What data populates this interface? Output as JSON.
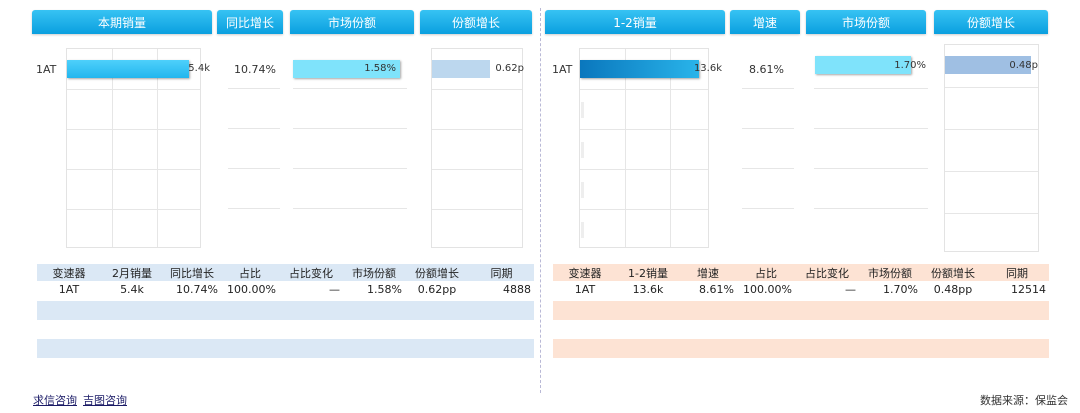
{
  "left": {
    "headers": {
      "sales": "本期销量",
      "yoy": "同比增长",
      "share": "市场份额",
      "share_growth": "份额增长"
    },
    "row_label": "1AT",
    "sales_value": "5.4k",
    "yoy_value": "10.74%",
    "share_value": "1.58%",
    "share_growth_value": "0.62p",
    "table": {
      "columns": [
        "变速器",
        "2月销量",
        "同比增长",
        "占比",
        "占比变化",
        "市场份额",
        "份额增长",
        "同期"
      ],
      "rows": [
        [
          "1AT",
          "5.4k",
          "10.74%",
          "100.00%",
          "—",
          "1.58%",
          "0.62pp",
          "4888"
        ]
      ]
    }
  },
  "right": {
    "headers": {
      "sales": "1-2销量",
      "speed": "增速",
      "share": "市场份额",
      "share_growth": "份额增长"
    },
    "row_label": "1AT",
    "sales_value": "13.6k",
    "speed_value": "8.61%",
    "share_value": "1.70%",
    "share_growth_value": "0.48p",
    "table": {
      "columns": [
        "变速器",
        "1-2销量",
        "增速",
        "占比",
        "占比变化",
        "市场份额",
        "份额增长",
        "同期"
      ],
      "rows": [
        [
          "1AT",
          "13.6k",
          "8.61%",
          "100.00%",
          "—",
          "1.70%",
          "0.48pp",
          "12514"
        ]
      ]
    }
  },
  "footer": {
    "link1": "求信咨询",
    "link2": "吉图咨询",
    "source": "数据来源：保监会"
  },
  "colors": {
    "header": "#0a9fdf",
    "bar_sales_left": "#2fc2f5",
    "bar_sales_right": "#0a87c9",
    "bar_share": "#7fe3fb",
    "bar_growth_left": "#bcd7ee",
    "bar_growth_right": "#9fbfe3",
    "table_left": "#dbe8f5",
    "table_right": "#fde3d4"
  }
}
